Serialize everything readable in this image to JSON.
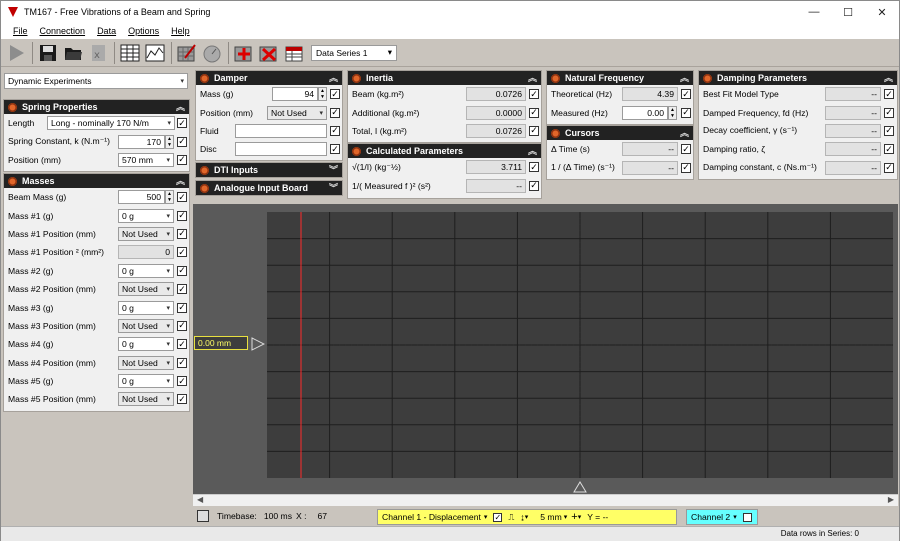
{
  "window": {
    "title": "TM167 - Free Vibrations of a Beam and Spring",
    "controls": [
      "—",
      "☐",
      "✕"
    ]
  },
  "menu": [
    "File",
    "Connection",
    "Data",
    "Options",
    "Help"
  ],
  "toolbar": {
    "data_series": "Data Series 1"
  },
  "experiment": {
    "selected": "Dynamic Experiments"
  },
  "spring": {
    "title": "Spring Properties",
    "length_label": "Length",
    "length_value": "Long - nominally 170 N/m",
    "k_label": "Spring Constant, k  (N.m⁻¹)",
    "k_value": "170",
    "pos_label": "Position  (mm)",
    "pos_value": "570 mm"
  },
  "masses": {
    "title": "Masses",
    "beam_label": "Beam Mass  (g)",
    "beam_value": "500",
    "rows": [
      {
        "label": "Mass #1  (g)",
        "value": "0 g",
        "type": "dd"
      },
      {
        "label": "Mass #1 Position  (mm)",
        "value": "Not Used",
        "type": "ddg"
      },
      {
        "label": "Mass #1 Position ² (mm²)",
        "value": "0",
        "type": "ro"
      },
      {
        "label": "Mass #2  (g)",
        "value": "0 g",
        "type": "dd"
      },
      {
        "label": "Mass #2 Position  (mm)",
        "value": "Not Used",
        "type": "ddg"
      },
      {
        "label": "Mass #3  (g)",
        "value": "0 g",
        "type": "dd"
      },
      {
        "label": "Mass #3 Position  (mm)",
        "value": "Not Used",
        "type": "ddg"
      },
      {
        "label": "Mass #4  (g)",
        "value": "0 g",
        "type": "dd"
      },
      {
        "label": "Mass #4 Position  (mm)",
        "value": "Not Used",
        "type": "ddg"
      },
      {
        "label": "Mass #5  (g)",
        "value": "0 g",
        "type": "dd"
      },
      {
        "label": "Mass #5 Position  (mm)",
        "value": "Not Used",
        "type": "ddg"
      }
    ]
  },
  "damper": {
    "title": "Damper",
    "mass_label": "Mass  (g)",
    "mass_value": "94",
    "position_label": "Position  (mm)",
    "position_value": "Not Used",
    "fluid_label": "Fluid",
    "fluid_value": "",
    "disc_label": "Disc",
    "disc_value": ""
  },
  "dti": {
    "title": "DTI Inputs"
  },
  "analogue": {
    "title": "Analogue Input Board"
  },
  "inertia": {
    "title": "Inertia",
    "beam_label": "Beam  (kg.m²)",
    "beam_value": "0.0726",
    "add_label": "Additional  (kg.m²)",
    "add_value": "0.0000",
    "total_label": "Total, I  (kg.m²)",
    "total_value": "0.0726"
  },
  "calc": {
    "title": "Calculated Parameters",
    "r1_label": "√(1/I)  (kg⁻½)",
    "r1_value": "3.711",
    "r2_label": "1/( Measured f )²  (s²)",
    "r2_value": "--"
  },
  "natfreq": {
    "title": "Natural Frequency",
    "theo_label": "Theoretical  (Hz)",
    "theo_value": "4.39",
    "meas_label": "Measured  (Hz)",
    "meas_value": "0.00"
  },
  "cursors": {
    "title": "Cursors",
    "dt_label": "Δ Time  (s)",
    "dt_value": "--",
    "inv_label": "1 / (Δ Time)  (s⁻¹)",
    "inv_value": "--"
  },
  "damping": {
    "title": "Damping Parameters",
    "rows": [
      {
        "label": "Best Fit Model Type",
        "value": "--"
      },
      {
        "label": "Damped Frequency, fd  (Hz)",
        "value": "--"
      },
      {
        "label": "Decay coefficient, γ  (s⁻¹)",
        "value": "--"
      },
      {
        "label": "Damping ratio, ζ",
        "value": "--"
      },
      {
        "label": "Damping constant, c  (Ns.m⁻¹)",
        "value": "--"
      }
    ]
  },
  "plot": {
    "marker_label": "0.00 mm"
  },
  "plotstatus": {
    "timebase_label": "Timebase:",
    "timebase_value": "100 ms",
    "x_label": "X :",
    "x_value": "67",
    "channel1": "Channel 1 - Displacement",
    "scale": "5 mm",
    "y_label": "Y = --",
    "channel2": "Channel 2"
  },
  "status": {
    "rows": "Data rows in Series: 0"
  },
  "colors": {
    "accent": "#e0662a",
    "trace_marker": "#ff2a2a",
    "channel1_bg": "#ffff66",
    "channel2_bg": "#66ffff"
  }
}
